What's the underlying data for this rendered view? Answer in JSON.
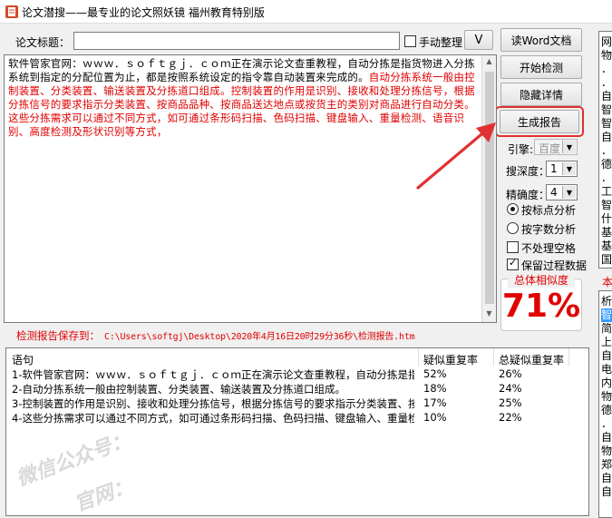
{
  "window": {
    "title": "论文潜搜——最专业的论文照妖镜 福州教育特别版"
  },
  "form": {
    "title_label": "论文标题：",
    "title_value": "",
    "manual_tidy_label": "手动整理",
    "manual_tidy_checked": false,
    "dropdown_glyph": "V"
  },
  "editor": {
    "black_segment": "软件管家官网：ｗｗｗ．ｓｏｆｔｇｊ．ｃｏｍ正在演示论文查重教程，自动分拣是指货物进入分拣系统到指定的分配位置为止，都是按照系统设定的指令靠自动装置来完成的。",
    "red_segment": "自动分拣系统一般由控制装置、分类装置、输送装置及分拣道口组成。控制装置的作用是识别、接收和处理分拣信号，根据分拣信号的要求指示分类装置、按商品品种、按商品送达地点或按货主的类别对商品进行自动分类。这些分拣需求可以通过不同方式，如可通过条形码扫描、色码扫描、键盘输入、重量检测、语音识别、高度检测及形状识别等方式，"
  },
  "buttons": {
    "read_word": "读Word文档",
    "start_check": "开始检测",
    "hide_details": "隐藏详情",
    "generate_report": "生成报告"
  },
  "options": {
    "engine_label": "引擎:",
    "engine_value": "百度",
    "depth_label": "搜深度：",
    "depth_value": "1",
    "precision_label": "精确度：",
    "precision_value": "4",
    "by_punct_label": "按标点分析",
    "by_punct_selected": true,
    "by_chars_label": "按字数分析",
    "by_chars_selected": false,
    "no_space_label": "不处理空格",
    "no_space_checked": false,
    "keep_process_label": "保留过程数据",
    "keep_process_checked": true
  },
  "similarity": {
    "label": "总体相似度",
    "value": "71%"
  },
  "report": {
    "save_label": "检测报告保存到：",
    "save_path": "C:\\Users\\softgj\\Desktop\\2020年4月16日20时29分36秒\\检测报告.htm"
  },
  "table": {
    "columns": [
      "语句",
      "疑似重复率",
      "总疑似重复率"
    ],
    "rows": [
      {
        "sentence": "1-软件管家官网：ｗｗｗ．ｓｏｆｔｇｊ．ｃｏｍ正在演示论文查重教程，自动分拣是指...",
        "rate": "52%",
        "total": "26%"
      },
      {
        "sentence": "2-自动分拣系统一般由控制装置、分类装置、输送装置及分拣道口组成。",
        "rate": "18%",
        "total": "24%"
      },
      {
        "sentence": "3-控制装置的作用是识别、接收和处理分拣信号，根据分拣信号的要求指示分类装置、按...",
        "rate": "17%",
        "total": "25%"
      },
      {
        "sentence": "4-这些分拣需求可以通过不同方式，如可通过条形码扫描、色码扫描、键盘输入、重量检...",
        "rate": "10%",
        "total": "22%"
      }
    ]
  },
  "watermark": {
    "line1": "微信公众号：",
    "line2": "官网："
  },
  "right_panel": {
    "top_chars": [
      "网",
      "物",
      "．",
      "．",
      "自",
      "智",
      "智",
      "自",
      "．",
      "德",
      "．",
      "工",
      "智",
      "什",
      "基",
      "基",
      "国"
    ],
    "mid_label": "本",
    "bottom_chars": [
      "析",
      "智",
      "简",
      "上",
      "自",
      "电",
      "内",
      "物",
      "德",
      "．",
      "自",
      "物",
      "郑",
      "自",
      "自"
    ]
  },
  "colors": {
    "red_text": "#e00000",
    "arrow": "#e03030",
    "highlight": "#e03030",
    "similarity": "#e00000",
    "selection": "#3399ff"
  },
  "icons": {
    "app": "app-logo-icon",
    "dropdown": "chevron-down-icon",
    "arrow": "annotation-arrow-icon"
  }
}
